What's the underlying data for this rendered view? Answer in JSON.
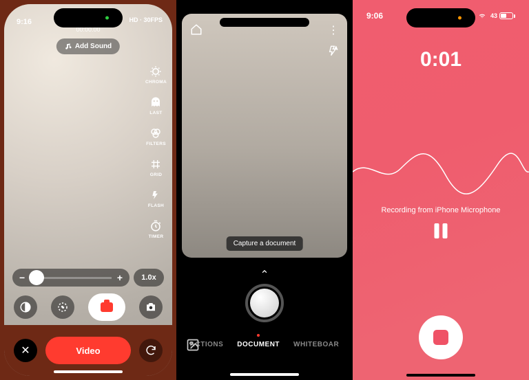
{
  "phone1": {
    "status_time": "9:16",
    "timer_main": "00:00.00",
    "timer_sub": "00:00.00",
    "quality": "HD · 30FPS",
    "add_sound": "Add Sound",
    "tools": {
      "chroma": "CHROMA",
      "last": "LAST",
      "filters": "FILTERS",
      "grid": "GRID",
      "flash": "FLASH",
      "timer": "TIMER"
    },
    "zoom_value": "1.0x",
    "mode_label": "Video"
  },
  "phone2": {
    "hint": "Capture a document",
    "modes": {
      "actions": "ACTIONS",
      "document": "DOCUMENT",
      "whiteboard": "WHITEBOAR"
    }
  },
  "phone3": {
    "status_time": "9:06",
    "battery_pct": "43",
    "rec_timer": "0:01",
    "rec_label": "Recording from iPhone Microphone"
  }
}
